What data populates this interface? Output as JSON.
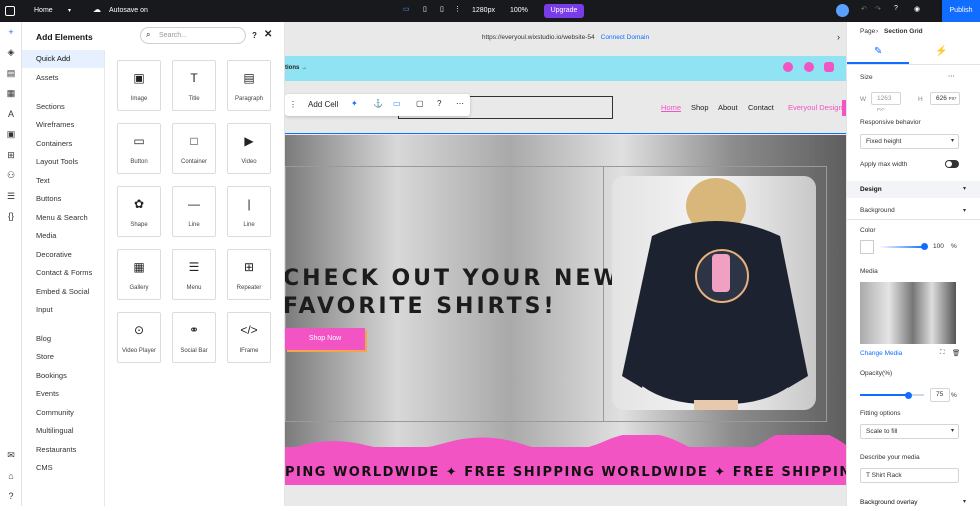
{
  "topbar": {
    "page_name": "Home",
    "autosave": "Autosave on",
    "resolution": "1280px",
    "zoom": "100%",
    "upgrade_label": "Upgrade",
    "publish_label": "Publish"
  },
  "add_panel": {
    "title": "Add Elements",
    "search_placeholder": "Search...",
    "categories": [
      "Quick Add",
      "Assets",
      "Sections",
      "Wireframes",
      "Containers",
      "Layout Tools",
      "Text",
      "Buttons",
      "Menu & Search",
      "Media",
      "Decorative",
      "Contact & Forms",
      "Embed & Social",
      "Input",
      "Blog",
      "Store",
      "Bookings",
      "Events",
      "Community",
      "Multilingual",
      "Restaurants",
      "CMS"
    ],
    "tiles": [
      "Image",
      "Title",
      "Paragraph",
      "Button",
      "Container",
      "Video",
      "Shape",
      "Line",
      "Line",
      "Gallery",
      "Menu",
      "Repeater",
      "Video Player",
      "Social Bar",
      "IFrame"
    ]
  },
  "canvas": {
    "url": "https://everyoul.wixstudio.io/website-54",
    "connect_domain": "Connect Domain",
    "promo_text": "tions →",
    "add_cell": "Add Cell",
    "nav": [
      "Home",
      "Shop",
      "About",
      "Contact",
      "Everyoul Design"
    ],
    "headline_1": "CHECK OUT YOUR NEW",
    "headline_2": "FAVORITE SHIRTS!",
    "shop_now": "Shop Now",
    "marquee": "PING WORLDWIDE ✦ FREE SHIPPING WORLDWIDE ✦ FREE SHIPPING WORLDWIDE"
  },
  "inspector": {
    "breadcrumb_page": "Page",
    "breadcrumb_current": "Section Grid",
    "size_label": "Size",
    "width_label": "W",
    "width_value": "1263",
    "width_unit": "PX*",
    "height_label": "H",
    "height_value": "626",
    "height_unit": "PX*",
    "responsive_label": "Responsive behavior",
    "responsive_value": "Fixed height",
    "max_width_label": "Apply max width",
    "design_label": "Design",
    "background_label": "Background",
    "color_label": "Color",
    "color_opacity": "100",
    "percent": "%",
    "media_label": "Media",
    "change_media": "Change Media",
    "opacity_label": "Opacity(%)",
    "opacity_value": "75",
    "fitting_label": "Fitting options",
    "fitting_value": "Scale to fill",
    "describe_label": "Describe your media",
    "describe_value": "T Shirt Rack",
    "overlay_label": "Background overlay"
  },
  "colors": {
    "accent": "#116dff",
    "upgrade": "#7a3ce8",
    "pink": "#f254c4",
    "cyan": "#8fe3f2"
  }
}
